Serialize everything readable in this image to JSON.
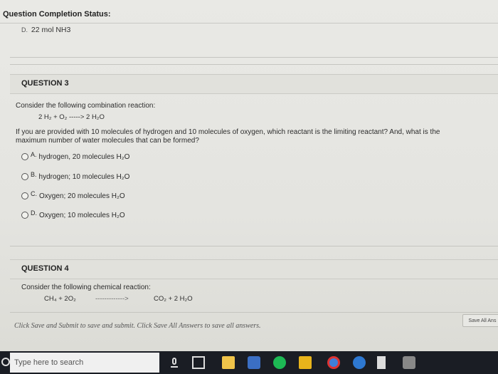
{
  "status": {
    "title": "Question Completion Status:"
  },
  "previous_answer": {
    "marker": "D.",
    "text": "22 mol NH3"
  },
  "question3": {
    "header": "QUESTION 3",
    "prompt": "Consider the following combination reaction:",
    "equation": "2 H₂ + O₂ -----> 2 H₂O",
    "question_line1": "If you are provided with 10 molecules of hydrogen and 10 molecules of oxygen, which reactant is the limiting reactant? And, what is the",
    "question_line2": "maximum number of water molecules that can be formed?",
    "options": [
      {
        "letter": "A.",
        "text": "hydrogen, 20 molecules H₂O"
      },
      {
        "letter": "B.",
        "text": "hydrogen; 10 molecules H₂O"
      },
      {
        "letter": "C.",
        "text": "Oxygen; 20 molecules H₂O"
      },
      {
        "letter": "D.",
        "text": "Oxygen; 10 molecules H₂O"
      }
    ]
  },
  "question4": {
    "header": "QUESTION 4",
    "prompt": "Consider the following chemical reaction:",
    "equation_left": "CH₄  +  2O₂",
    "equation_arrow": "------------->",
    "equation_right": "CO₂  +  2 H₂O"
  },
  "footer": {
    "note": "Click Save and Submit to save and submit. Click Save All Answers to save all answers.",
    "save_all_label": "Save All Ans"
  },
  "taskbar": {
    "search_placeholder": "Type here to search"
  }
}
